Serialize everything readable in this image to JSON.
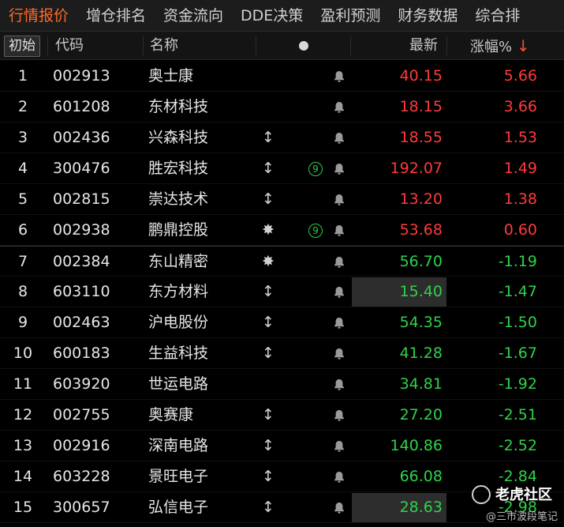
{
  "tabs": [
    "行情报价",
    "增仓排名",
    "资金流向",
    "DDE决策",
    "盈利预测",
    "财务数据",
    "综合排"
  ],
  "header": {
    "init_label": "初始",
    "code_label": "代码",
    "name_label": "名称",
    "last_label": "最新",
    "pct_label": "涨幅%",
    "sort_arrow": "↓"
  },
  "rows": [
    {
      "rank": "1",
      "code": "002913",
      "name": "奥士康",
      "flag": "",
      "circle": "",
      "last": "40.15",
      "pct": "5.66",
      "dir": "up",
      "hl": false
    },
    {
      "rank": "2",
      "code": "601208",
      "name": "东材科技",
      "flag": "",
      "circle": "",
      "last": "18.15",
      "pct": "3.66",
      "dir": "up",
      "hl": false
    },
    {
      "rank": "3",
      "code": "002436",
      "name": "兴森科技",
      "flag": "↕",
      "circle": "",
      "last": "18.55",
      "pct": "1.53",
      "dir": "up",
      "hl": false
    },
    {
      "rank": "4",
      "code": "300476",
      "name": "胜宏科技",
      "flag": "↕",
      "circle": "9",
      "last": "192.07",
      "pct": "1.49",
      "dir": "up",
      "hl": false
    },
    {
      "rank": "5",
      "code": "002815",
      "name": "崇达技术",
      "flag": "↕",
      "circle": "",
      "last": "13.20",
      "pct": "1.38",
      "dir": "up",
      "hl": false
    },
    {
      "rank": "6",
      "code": "002938",
      "name": "鹏鼎控股",
      "flag": "✸",
      "circle": "9",
      "last": "53.68",
      "pct": "0.60",
      "dir": "up",
      "hl": false
    },
    {
      "rank": "7",
      "code": "002384",
      "name": "东山精密",
      "flag": "✸",
      "circle": "",
      "last": "56.70",
      "pct": "-1.19",
      "dir": "down",
      "hl": false
    },
    {
      "rank": "8",
      "code": "603110",
      "name": "东方材料",
      "flag": "↕",
      "circle": "",
      "last": "15.40",
      "pct": "-1.47",
      "dir": "down",
      "hl": true
    },
    {
      "rank": "9",
      "code": "002463",
      "name": "沪电股份",
      "flag": "↕",
      "circle": "",
      "last": "54.35",
      "pct": "-1.50",
      "dir": "down",
      "hl": false
    },
    {
      "rank": "10",
      "code": "600183",
      "name": "生益科技",
      "flag": "↕",
      "circle": "",
      "last": "41.28",
      "pct": "-1.67",
      "dir": "down",
      "hl": false
    },
    {
      "rank": "11",
      "code": "603920",
      "name": "世运电路",
      "flag": "",
      "circle": "",
      "last": "34.81",
      "pct": "-1.92",
      "dir": "down",
      "hl": false
    },
    {
      "rank": "12",
      "code": "002755",
      "name": "奥赛康",
      "flag": "↕",
      "circle": "",
      "last": "27.20",
      "pct": "-2.51",
      "dir": "down",
      "hl": false
    },
    {
      "rank": "13",
      "code": "002916",
      "name": "深南电路",
      "flag": "↕",
      "circle": "",
      "last": "140.86",
      "pct": "-2.52",
      "dir": "down",
      "hl": false
    },
    {
      "rank": "14",
      "code": "603228",
      "name": "景旺电子",
      "flag": "↕",
      "circle": "",
      "last": "66.08",
      "pct": "-2.84",
      "dir": "down",
      "hl": false
    },
    {
      "rank": "15",
      "code": "300657",
      "name": "弘信电子",
      "flag": "↕",
      "circle": "",
      "last": "28.63",
      "pct": "-2.98",
      "dir": "down",
      "hl": true
    }
  ],
  "colors": {
    "up": "#ff3a3a",
    "down": "#2fd24a",
    "active_tab": "#ff6a2a"
  },
  "icons": {
    "bell": "bell-icon",
    "circle": "circled-number-icon"
  },
  "watermark": {
    "title": "老虎社区",
    "subtitle": "@三市波段笔记"
  }
}
